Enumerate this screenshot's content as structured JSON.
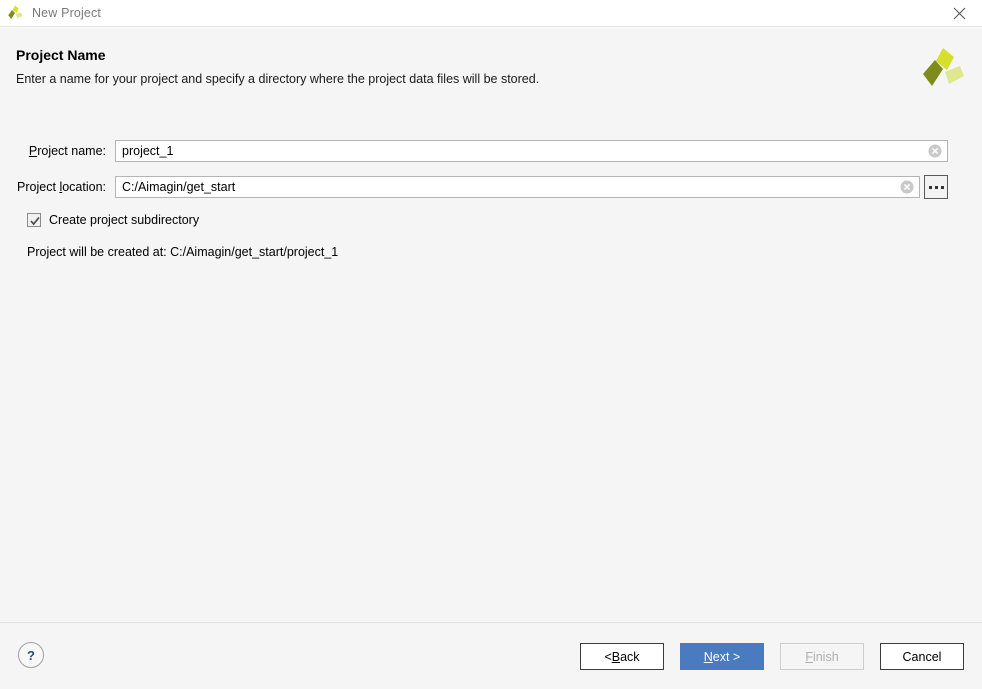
{
  "window": {
    "title": "New Project",
    "app_icon": "aimagin-pinwheel-logo",
    "close_icon": "close-icon"
  },
  "header": {
    "title": "Project Name",
    "subtitle": "Enter a name for your project and specify a directory where the project data files will be stored.",
    "logo_icon": "aimagin-pinwheel-logo"
  },
  "form": {
    "project_name": {
      "label_prefix": "",
      "label_mnemonic": "P",
      "label_suffix": "roject name:",
      "value": "project_1",
      "placeholder": "",
      "clear_icon": "clear-circle-icon"
    },
    "project_location": {
      "label_prefix": "Project ",
      "label_mnemonic": "l",
      "label_suffix": "ocation:",
      "value": "C:/Aimagin/get_start",
      "placeholder": "",
      "clear_icon": "clear-circle-icon",
      "browse_label": "...",
      "browse_icon": "ellipsis-icon"
    },
    "create_subdirectory": {
      "label": "Create project subdirectory",
      "checked": true,
      "check_icon": "checkmark-icon"
    },
    "created_at": "Project will be created at: C:/Aimagin/get_start/project_1"
  },
  "footer": {
    "help_label": "?",
    "help_icon": "question-mark-icon",
    "buttons": {
      "back": {
        "prefix": "< ",
        "mnemonic": "B",
        "suffix": "ack",
        "enabled": true
      },
      "next": {
        "prefix": "",
        "mnemonic": "N",
        "suffix": "ext >",
        "enabled": true,
        "primary": true
      },
      "finish": {
        "prefix": "",
        "mnemonic": "F",
        "suffix": "inish",
        "enabled": false
      },
      "cancel": {
        "prefix": "",
        "mnemonic": "",
        "suffix": "Cancel",
        "enabled": true
      }
    }
  },
  "colors": {
    "accent_blue": "#4a7ac0",
    "window_bg": "#f5f5f5",
    "titlebar_bg": "#ffffff",
    "input_bg": "#ffffff",
    "input_border": "#b4b4b4",
    "logo_top": "#d4e02a",
    "logo_left": "#7f8c1b",
    "logo_right": "#dfe88f",
    "help_blue": "#2d4a77",
    "disabled_text": "#b0b0b0"
  }
}
